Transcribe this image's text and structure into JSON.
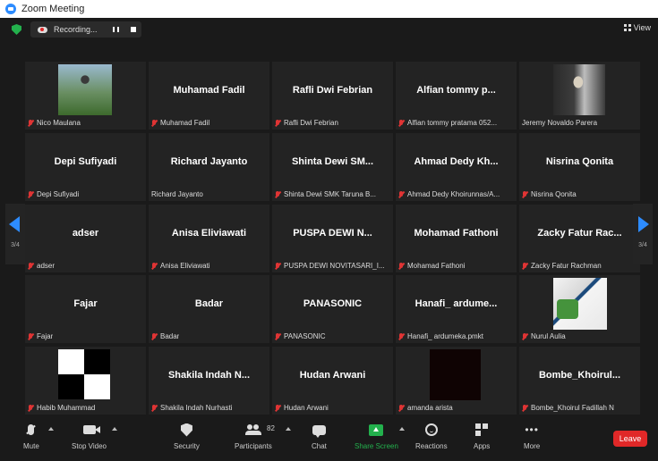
{
  "window": {
    "title": "Zoom Meeting"
  },
  "recording": {
    "label": "Recording..."
  },
  "view": {
    "label": "View"
  },
  "navigation": {
    "page_left": "3/4",
    "page_right": "3/4"
  },
  "tiles": [
    {
      "name": "",
      "label": "Nico Maulana",
      "muted": true,
      "media": "photo-nico"
    },
    {
      "name": "Muhamad Fadil",
      "label": "Muhamad Fadil",
      "muted": true,
      "media": ""
    },
    {
      "name": "Rafli Dwi Febrian",
      "label": "Rafli Dwi Febrian",
      "muted": true,
      "media": ""
    },
    {
      "name": "Alfian tommy p...",
      "label": "Alfian tommy pratama 052...",
      "muted": true,
      "media": ""
    },
    {
      "name": "",
      "label": "Jeremy Novaldo Parera",
      "muted": false,
      "media": "photo-jeremy"
    },
    {
      "name": "Depi Sufiyadi",
      "label": "Depi Sufiyadi",
      "muted": true,
      "media": ""
    },
    {
      "name": "Richard Jayanto",
      "label": "Richard Jayanto",
      "muted": false,
      "media": ""
    },
    {
      "name": "Shinta Dewi SM...",
      "label": "Shinta Dewi SMK Taruna B...",
      "muted": true,
      "media": ""
    },
    {
      "name": "Ahmad Dedy Kh...",
      "label": "Ahmad Dedy Khoirunnas/A...",
      "muted": true,
      "media": ""
    },
    {
      "name": "Nisrina Qonita",
      "label": "Nisrina Qonita",
      "muted": true,
      "media": ""
    },
    {
      "name": "adser",
      "label": "adser",
      "muted": true,
      "media": ""
    },
    {
      "name": "Anisa Eliviawati",
      "label": "Anisa Eliviawati",
      "muted": true,
      "media": ""
    },
    {
      "name": "PUSPA DEWI N...",
      "label": "PUSPA DEWI NOVITASARI_I...",
      "muted": true,
      "media": ""
    },
    {
      "name": "Mohamad Fathoni",
      "label": "Mohamad Fathoni",
      "muted": true,
      "media": ""
    },
    {
      "name": "Zacky Fatur Rac...",
      "label": "Zacky Fatur Rachman",
      "muted": true,
      "media": ""
    },
    {
      "name": "Fajar",
      "label": "Fajar",
      "muted": true,
      "media": ""
    },
    {
      "name": "Badar",
      "label": "Badar",
      "muted": true,
      "media": ""
    },
    {
      "name": "PANASONIC",
      "label": "PANASONIC",
      "muted": true,
      "media": ""
    },
    {
      "name": "Hanafi_ ardume...",
      "label": "Hanafi_ ardumeka.pmkt",
      "muted": true,
      "media": ""
    },
    {
      "name": "",
      "label": "Nurul Aulia",
      "muted": true,
      "media": "photo-nurul"
    },
    {
      "name": "",
      "label": "Habib Muhammad",
      "muted": true,
      "media": "checker"
    },
    {
      "name": "Shakila Indah N...",
      "label": "Shakila Indah Nurhasti",
      "muted": true,
      "media": ""
    },
    {
      "name": "Hudan Arwani",
      "label": "Hudan Arwani",
      "muted": true,
      "media": ""
    },
    {
      "name": "",
      "label": "amanda arista",
      "muted": true,
      "media": "blackbox"
    },
    {
      "name": "Bombe_Khoirul...",
      "label": "Bombe_Khoirul Fadillah N",
      "muted": true,
      "media": ""
    }
  ],
  "toolbar": {
    "mute": "Mute",
    "stop_video": "Stop Video",
    "security": "Security",
    "participants": "Participants",
    "participant_count": "82",
    "chat": "Chat",
    "share_screen": "Share Screen",
    "reactions": "Reactions",
    "apps": "Apps",
    "more": "More",
    "leave": "Leave"
  },
  "colors": {
    "accent": "#2d8cff",
    "share_green": "#23b14d",
    "leave_red": "#e02828",
    "muted_red": "#e03434",
    "tile_bg": "#232323"
  },
  "icons": [
    "zoom-app-icon",
    "encryption-shield-icon",
    "cloud-record-icon",
    "pause-icon",
    "stop-icon",
    "grid-view-icon",
    "mic-muted-icon",
    "chevron-left-icon",
    "chevron-right-icon",
    "microphone-icon",
    "video-camera-icon",
    "security-shield-icon",
    "participants-icon",
    "chat-bubble-icon",
    "share-screen-icon",
    "reactions-icon",
    "apps-icon",
    "more-icon"
  ]
}
